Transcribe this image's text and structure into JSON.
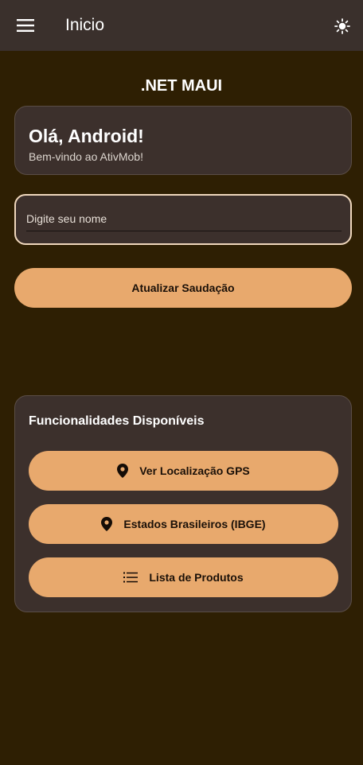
{
  "app": {
    "title": "Inicio",
    "brand": ".NET MAUI"
  },
  "greeting": {
    "title": "Olá, Android!",
    "subtitle": "Bem-vindo ao AtivMob!"
  },
  "name_input": {
    "placeholder": "Digite seu nome",
    "value": ""
  },
  "update_button": {
    "label": "Atualizar Saudação"
  },
  "features": {
    "title": "Funcionalidades Disponíveis",
    "items": [
      {
        "label": "Ver Localização GPS",
        "icon": "location-pin-icon"
      },
      {
        "label": "Estados Brasileiros (IBGE)",
        "icon": "location-pin-icon"
      },
      {
        "label": "Lista de Produtos",
        "icon": "list-icon"
      }
    ]
  },
  "colors": {
    "background": "#2e1f03",
    "surface": "#3c302c",
    "accent": "#e8a96d"
  },
  "icons": {
    "menu": "menu-icon",
    "theme": "sun-icon"
  }
}
